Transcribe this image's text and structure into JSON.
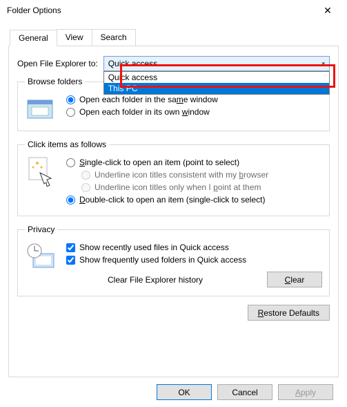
{
  "window": {
    "title": "Folder Options"
  },
  "tabs": {
    "general": "General",
    "view": "View",
    "search": "Search"
  },
  "open_explorer": {
    "label": "Open File Explorer to:",
    "selected": "Quick access",
    "options": {
      "quick": "Quick access",
      "thispc": "This PC"
    }
  },
  "browse": {
    "legend": "Browse folders",
    "same": "Open each folder in the same window",
    "own": "Open each folder in its own window"
  },
  "click": {
    "legend": "Click items as follows",
    "single": "Single-click to open an item (point to select)",
    "ul_browser": "Underline icon titles consistent with my browser",
    "ul_point": "Underline icon titles only when I point at them",
    "double": "Double-click to open an item (single-click to select)"
  },
  "privacy": {
    "legend": "Privacy",
    "recent": "Show recently used files in Quick access",
    "frequent": "Show frequently used folders in Quick access",
    "clear_label": "Clear File Explorer history",
    "clear_btn": "Clear"
  },
  "restore": "Restore Defaults",
  "footer": {
    "ok": "OK",
    "cancel": "Cancel",
    "apply": "Apply"
  },
  "accel": {
    "s": "S",
    "m": "m",
    "w": "w",
    "single_s": "S",
    "b": "b",
    "p": "p",
    "d": "D",
    "c": "C",
    "r": "R",
    "a": "A"
  }
}
